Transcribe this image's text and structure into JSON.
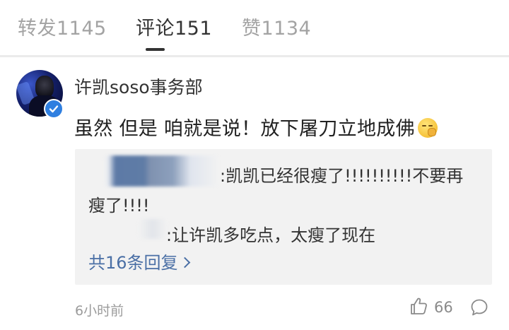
{
  "tabs": [
    {
      "label": "转发1145",
      "active": false
    },
    {
      "label": "评论151",
      "active": true
    },
    {
      "label": "赞1134",
      "active": false
    }
  ],
  "comment": {
    "username": "许凯soso事务部",
    "verified": true,
    "text": "虽然 但是 咱就是说！放下屠刀立地成佛",
    "emoji": "shushing-face-emoji",
    "replies": [
      {
        "text_line1": ":凯凯已经很瘦了!!!!!!!!!!不要再",
        "text_line2": "瘦了!!!!"
      },
      {
        "text": ":让许凯多吃点，太瘦了现在"
      }
    ],
    "more_replies": "共16条回复",
    "timestamp": "6小时前",
    "like_count": "66",
    "icons": {
      "like": "thumbs-up-icon",
      "reply": "comment-bubble-icon",
      "verified": "verified-badge-icon",
      "more": "chevron-right-icon"
    }
  },
  "colors": {
    "accent_link": "#4a6fa5",
    "verified_blue": "#2f7fe0",
    "tab_active": "#333333",
    "tab_inactive": "#a3a3a3",
    "reply_background": "#f2f2f2"
  }
}
